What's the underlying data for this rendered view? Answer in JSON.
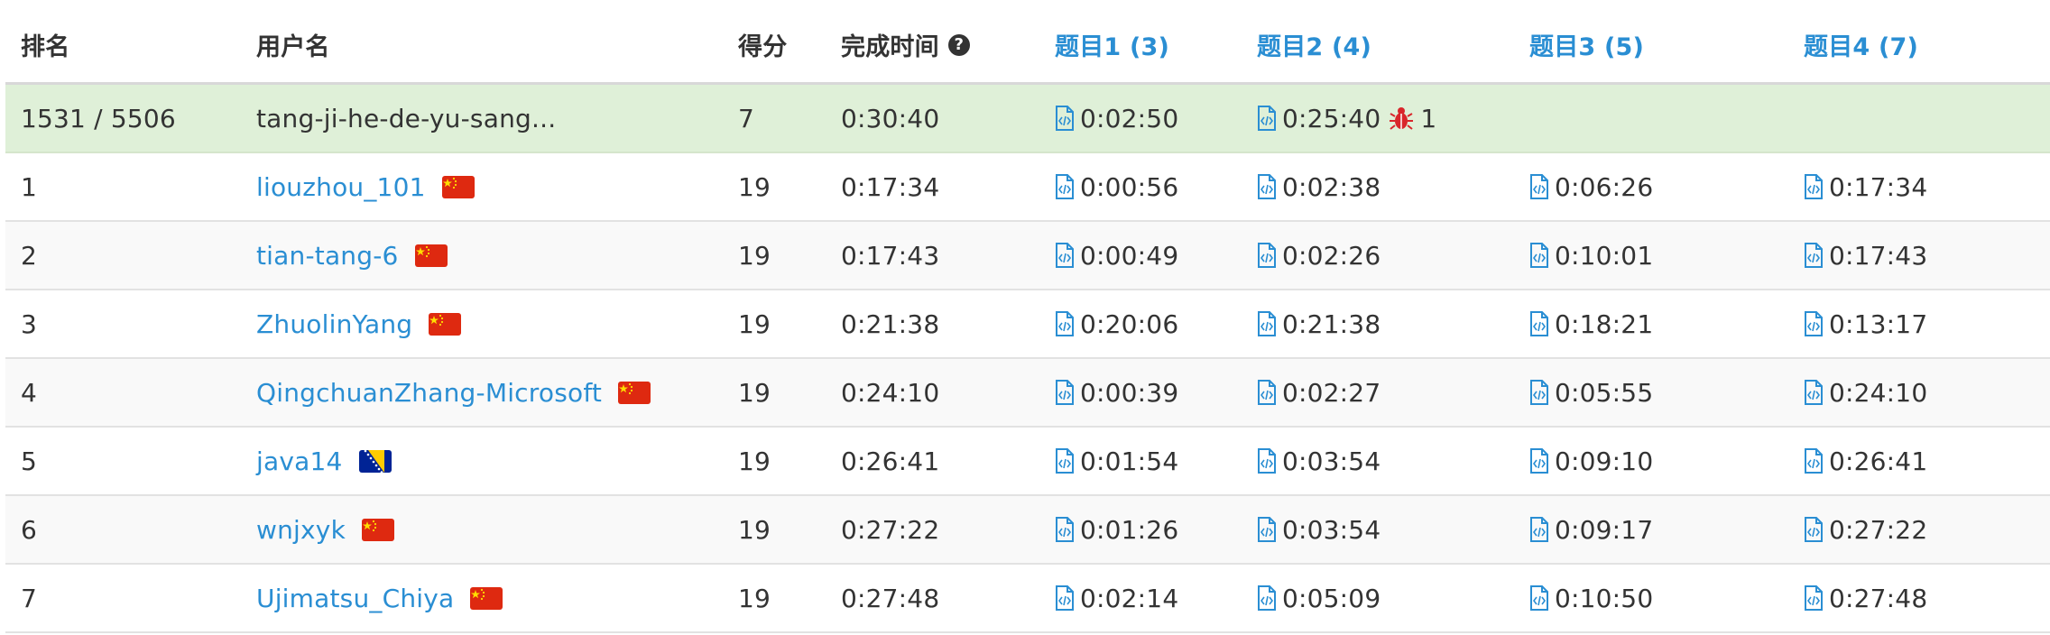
{
  "header": {
    "rank": "排名",
    "user": "用户名",
    "score": "得分",
    "finish_time": "完成时间",
    "help_glyph": "?",
    "q1": "题目1 (3)",
    "q2": "题目2 (4)",
    "q3": "题目3 (5)",
    "q4": "题目4 (7)"
  },
  "me": {
    "rank": "1531 / 5506",
    "user": "tang-ji-he-de-yu-sang...",
    "score": "7",
    "finish_time": "0:30:40",
    "q1": "0:02:50",
    "q2": "0:25:40",
    "q2_wrong": "1"
  },
  "rows": [
    {
      "rank": "1",
      "user": "liouzhou_101",
      "flag": "china-flag",
      "score": "19",
      "finish_time": "0:17:34",
      "q1": "0:00:56",
      "q2": "0:02:38",
      "q3": "0:06:26",
      "q4": "0:17:34"
    },
    {
      "rank": "2",
      "user": "tian-tang-6",
      "flag": "china-flag",
      "score": "19",
      "finish_time": "0:17:43",
      "q1": "0:00:49",
      "q2": "0:02:26",
      "q3": "0:10:01",
      "q4": "0:17:43"
    },
    {
      "rank": "3",
      "user": "ZhuolinYang",
      "flag": "china-flag",
      "score": "19",
      "finish_time": "0:21:38",
      "q1": "0:20:06",
      "q2": "0:21:38",
      "q3": "0:18:21",
      "q4": "0:13:17"
    },
    {
      "rank": "4",
      "user": "QingchuanZhang-Microsoft",
      "flag": "china-flag",
      "score": "19",
      "finish_time": "0:24:10",
      "q1": "0:00:39",
      "q2": "0:02:27",
      "q3": "0:05:55",
      "q4": "0:24:10"
    },
    {
      "rank": "5",
      "user": "java14",
      "flag": "bosnia-flag",
      "score": "19",
      "finish_time": "0:26:41",
      "q1": "0:01:54",
      "q2": "0:03:54",
      "q3": "0:09:10",
      "q4": "0:26:41"
    },
    {
      "rank": "6",
      "user": "wnjxyk",
      "flag": "china-flag",
      "score": "19",
      "finish_time": "0:27:22",
      "q1": "0:01:26",
      "q2": "0:03:54",
      "q3": "0:09:17",
      "q4": "0:27:22"
    },
    {
      "rank": "7",
      "user": "Ujimatsu_Chiya",
      "flag": "china-flag",
      "score": "19",
      "finish_time": "0:27:48",
      "q1": "0:02:14",
      "q2": "0:05:09",
      "q3": "0:10:50",
      "q4": "0:27:48"
    }
  ],
  "colors": {
    "link": "#2a8ed3",
    "highlight_row": "#dff0d8",
    "stripe": "#f9f9f9",
    "bug": "#d9262b",
    "china_red": "#de2910",
    "china_star": "#ffde00",
    "bosnia_blue": "#002395",
    "bosnia_yellow": "#fecb00"
  }
}
